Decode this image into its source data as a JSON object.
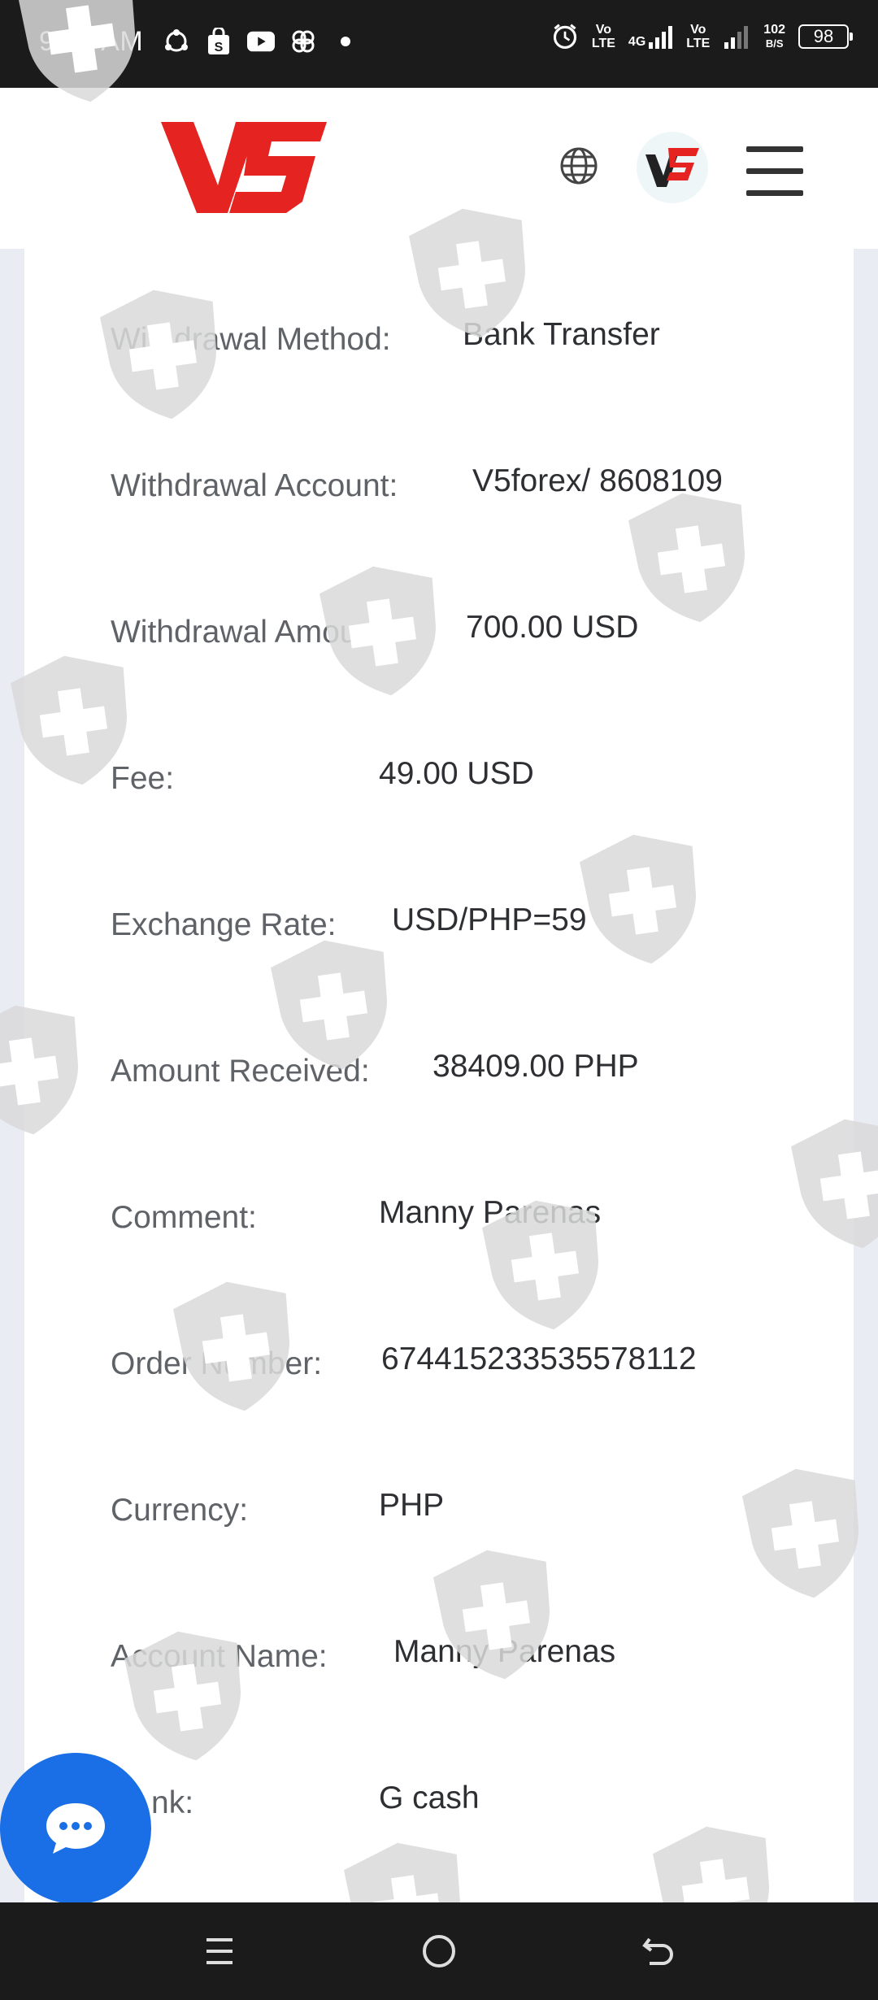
{
  "status_bar": {
    "time": "9:12 AM",
    "left_icons": [
      "share-icon",
      "shop-icon",
      "youtube-icon",
      "pinwheel-icon",
      "dot-icon"
    ],
    "right_icons": [
      "alarm-icon",
      "volte-icon",
      "4g-signal-icon",
      "volte-icon",
      "signal-icon"
    ],
    "volte_label_1": "Vo\nLTE",
    "network_label": "4G",
    "volte_label_2": "Vo\nLTE",
    "data_speed": "102",
    "data_unit": "B/S",
    "battery": "98"
  },
  "header": {
    "logo_text": "V5",
    "icons": [
      "globe-icon",
      "avatar-icon",
      "menu-icon"
    ]
  },
  "details": [
    {
      "label": "Withdrawal Method:",
      "value": "Bank Transfer"
    },
    {
      "label": "Withdrawal Account:",
      "value": "V5forex/ 8608109"
    },
    {
      "label": "Withdrawal Amount:",
      "value": "700.00 USD"
    },
    {
      "label": "Fee:",
      "value": "49.00 USD"
    },
    {
      "label": "Exchange Rate:",
      "value": "USD/PHP=59"
    },
    {
      "label": "Amount Received:",
      "value": "38409.00 PHP"
    },
    {
      "label": "Comment:",
      "value": "Manny Parenas"
    },
    {
      "label": "Order Number:",
      "value": "674415233535578112"
    },
    {
      "label": "Currency:",
      "value": "PHP"
    },
    {
      "label": "Account Name:",
      "value": "Manny Parenas"
    },
    {
      "label": "nk:",
      "value": "G cash"
    }
  ],
  "chat": {
    "icon": "chat-bubble-icon"
  },
  "nav_bar": {
    "icons": [
      "recents-icon",
      "home-icon",
      "back-icon"
    ]
  },
  "colors": {
    "brand_red": "#e52421",
    "chat_blue": "#1a6ee6",
    "label_gray": "#5f6368",
    "value_dark": "#2d2f33",
    "watermark_gray": "#d9d9d9"
  }
}
